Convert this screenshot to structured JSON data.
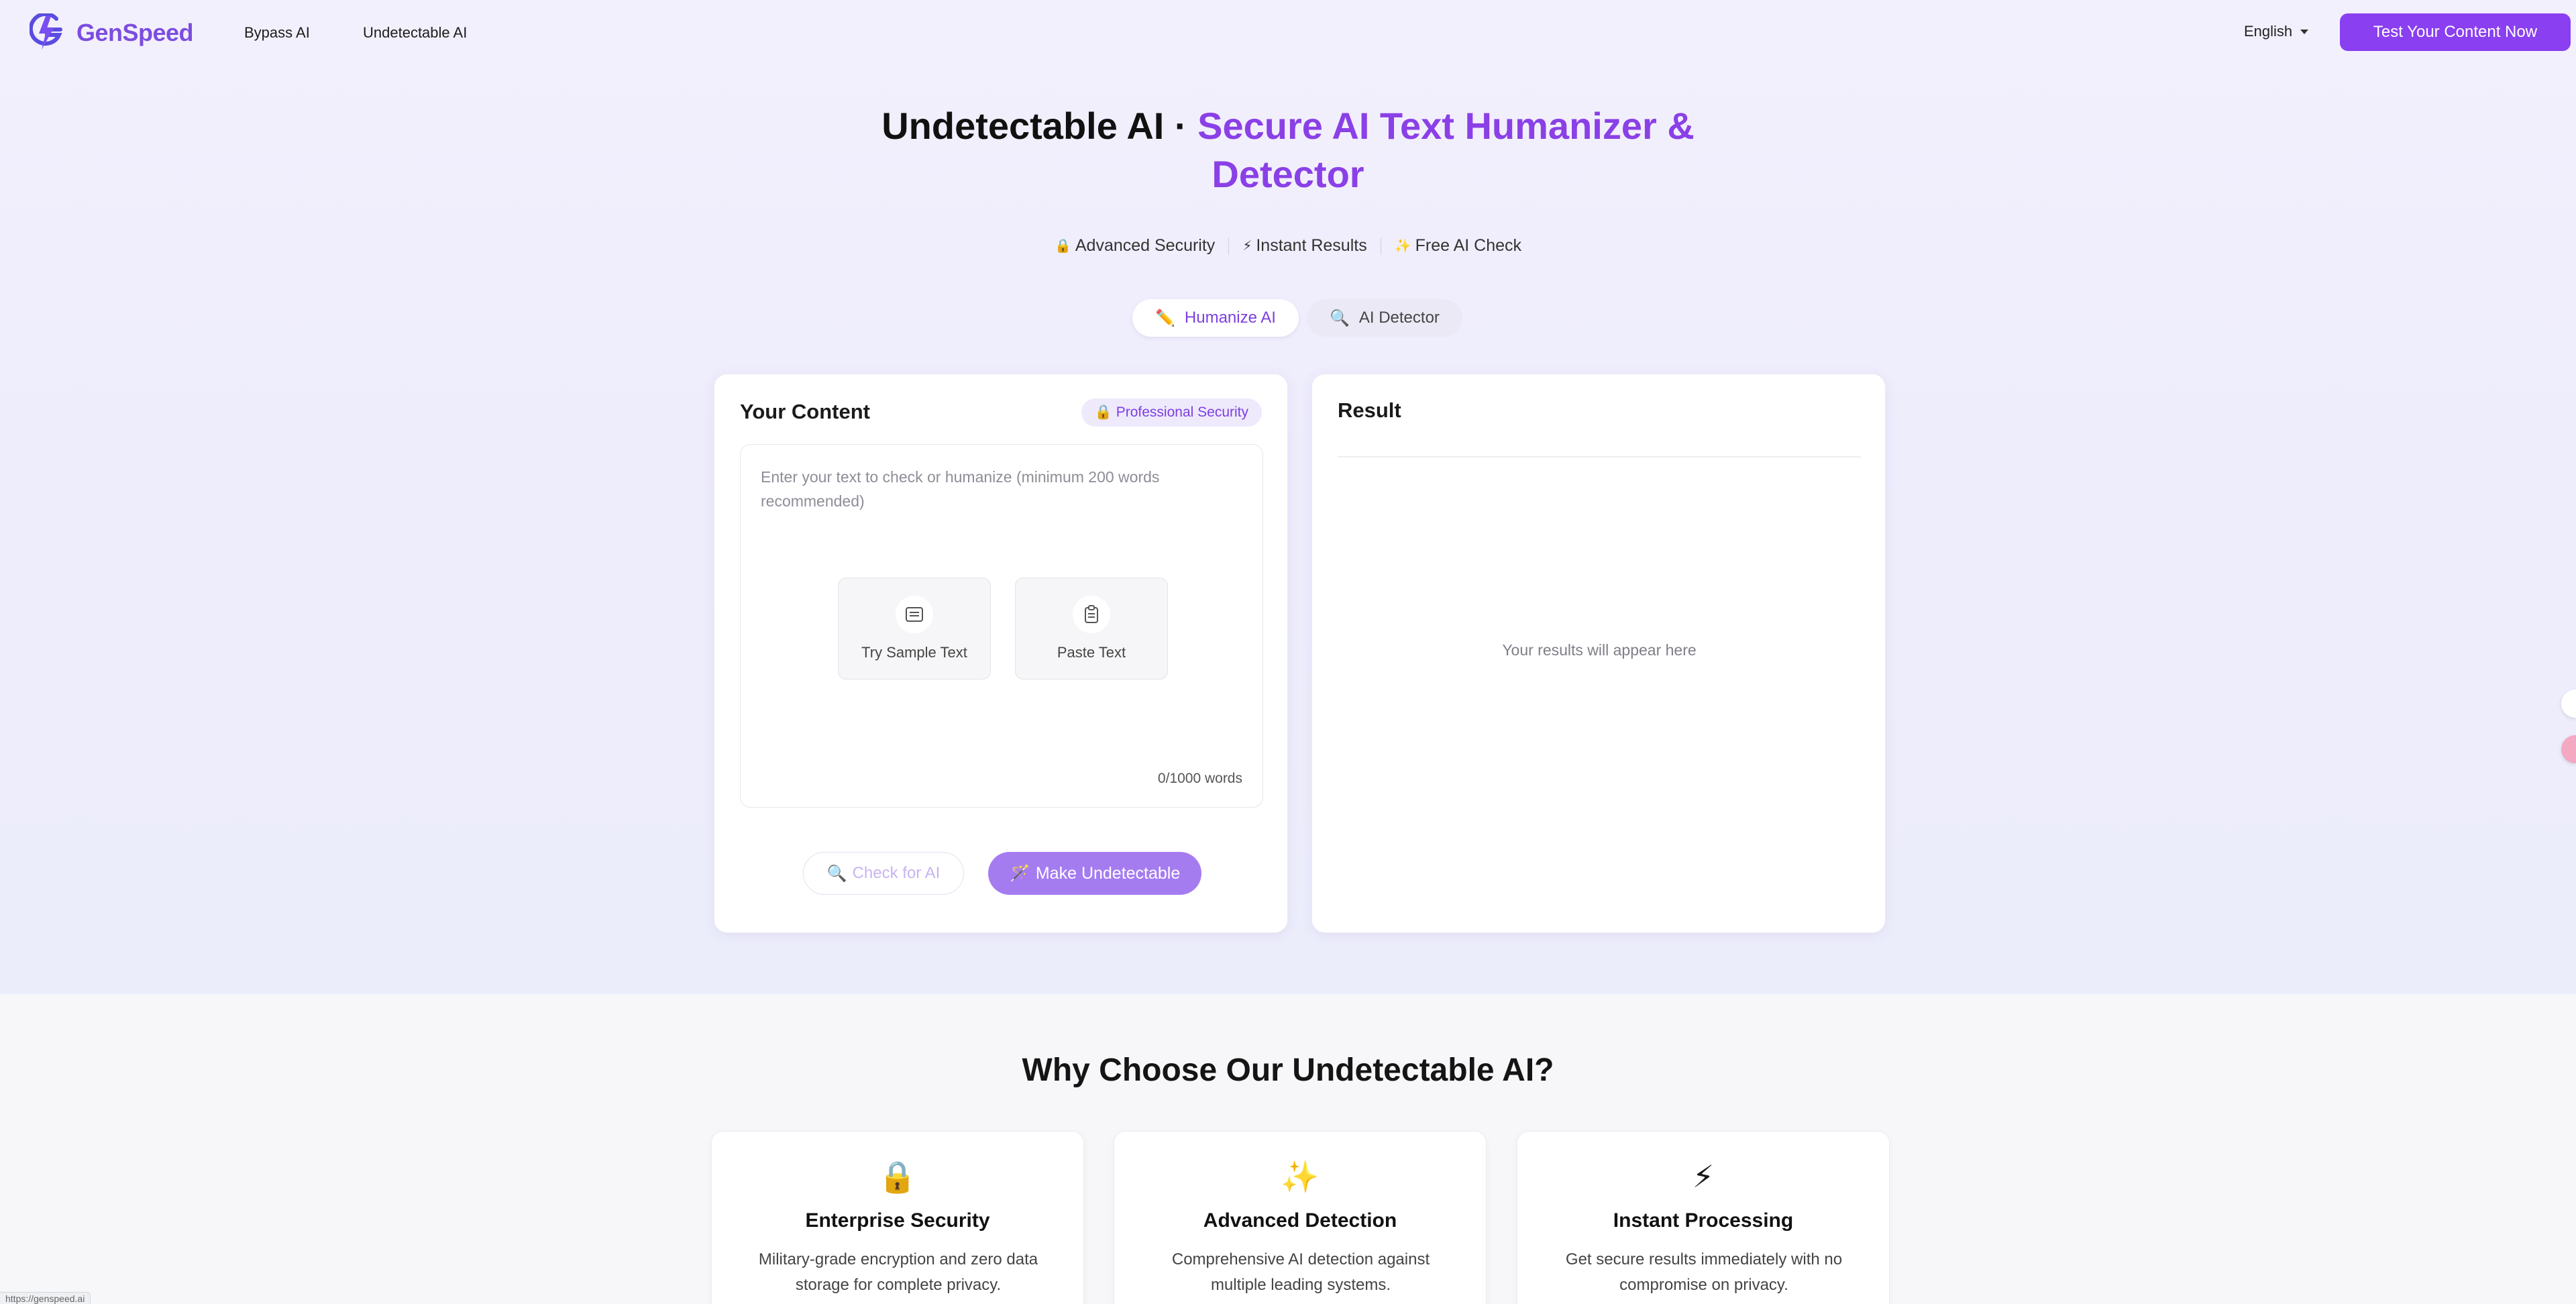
{
  "nav": {
    "brand": "GenSpeed",
    "links": [
      "Bypass AI",
      "Undetectable AI"
    ],
    "language": "English",
    "cta": "Test Your Content Now"
  },
  "hero": {
    "title_main": "Undetectable AI · ",
    "title_accent": "Secure AI Text Humanizer & Detector",
    "features": [
      {
        "icon": "lock-icon",
        "glyph": "🔒",
        "label": "Advanced Security"
      },
      {
        "icon": "lightning-icon",
        "glyph": "⚡",
        "label": "Instant Results"
      },
      {
        "icon": "sparkles-icon",
        "glyph": "✨",
        "label": "Free AI Check"
      }
    ],
    "tabs": [
      {
        "glyph": "✏️",
        "label": "Humanize AI",
        "active": true
      },
      {
        "glyph": "🔍",
        "label": "AI Detector",
        "active": false
      }
    ]
  },
  "content_panel": {
    "title": "Your Content",
    "badge": "Professional Security",
    "placeholder": "Enter your text to check or humanize (minimum 200 words recommended)",
    "sample_button": "Try Sample Text",
    "paste_button": "Paste Text",
    "word_count": "0/1000 words",
    "check_button": "Check for AI",
    "make_button": "Make Undetectable"
  },
  "result_panel": {
    "title": "Result",
    "empty_text": "Your results will appear here"
  },
  "why": {
    "title": "Why Choose Our Undetectable AI?",
    "cards": [
      {
        "icon": "lock-icon",
        "glyph": "🔒",
        "title": "Enterprise Security",
        "desc": "Military-grade encryption and zero data storage for complete privacy."
      },
      {
        "icon": "sparkles-icon",
        "glyph": "✨",
        "title": "Advanced Detection",
        "desc": "Comprehensive AI detection against multiple leading systems."
      },
      {
        "icon": "lightning-icon",
        "glyph": "⚡",
        "title": "Instant Processing",
        "desc": "Get secure results immediately with no compromise on privacy."
      }
    ]
  },
  "status_bar": {
    "url": "https://genspeed.ai"
  },
  "colors": {
    "brand": "#8a3ff0",
    "accent_text": "#8a40e6",
    "button_light": "#a57cf0"
  }
}
